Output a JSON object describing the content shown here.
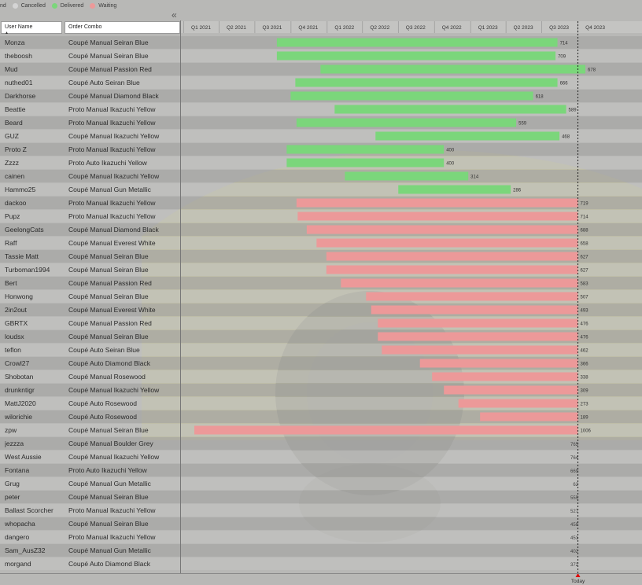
{
  "legend": {
    "items": [
      {
        "label": "nd",
        "color": ""
      },
      {
        "label": "Cancelled",
        "color": "#d4d4d4"
      },
      {
        "label": "Delivered",
        "color": "#7bd67b"
      },
      {
        "label": "Waiting",
        "color": "#ec9999"
      }
    ]
  },
  "table": {
    "headers": {
      "user": "User Name",
      "order": "Order Combo"
    },
    "rows": [
      {
        "user": "Monza",
        "order": "Coupé Manual Seiran Blue"
      },
      {
        "user": "theboosh",
        "order": "Coupé Manual Seiran Blue"
      },
      {
        "user": "Mud",
        "order": "Coupé Manual Passion Red"
      },
      {
        "user": "nuthed01",
        "order": "Coupé Auto Seiran Blue"
      },
      {
        "user": "Darkhorse",
        "order": "Coupé Manual Diamond Black"
      },
      {
        "user": "Beattie",
        "order": "Proto Manual Ikazuchi Yellow"
      },
      {
        "user": "Beard",
        "order": "Proto Manual Ikazuchi Yellow"
      },
      {
        "user": "GUZ",
        "order": "Coupé Manual Ikazuchi Yellow"
      },
      {
        "user": "Proto Z",
        "order": "Proto Manual Ikazuchi Yellow"
      },
      {
        "user": "Zzzz",
        "order": "Proto Auto Ikazuchi Yellow"
      },
      {
        "user": "cainen",
        "order": "Coupé Manual Ikazuchi Yellow"
      },
      {
        "user": "Hammo25",
        "order": "Coupé Manual Gun Metallic"
      },
      {
        "user": "dackoo",
        "order": "Proto Manual Ikazuchi Yellow"
      },
      {
        "user": "Pupz",
        "order": "Proto Manual Ikazuchi Yellow"
      },
      {
        "user": "GeelongCats",
        "order": "Coupé Manual Diamond Black"
      },
      {
        "user": "Raff",
        "order": "Coupé Manual Everest White"
      },
      {
        "user": "Tassie Matt",
        "order": "Coupé Manual Seiran Blue"
      },
      {
        "user": "Turboman1994",
        "order": "Coupé Manual Seiran Blue"
      },
      {
        "user": "Bert",
        "order": "Coupé Manual Passion Red"
      },
      {
        "user": "Honwong",
        "order": "Coupé Manual Seiran Blue"
      },
      {
        "user": "2in2out",
        "order": "Coupé Manual Everest White"
      },
      {
        "user": "GBRTX",
        "order": "Coupé Manual Passion Red"
      },
      {
        "user": "loudsx",
        "order": "Coupé Manual Seiran Blue"
      },
      {
        "user": "teflon",
        "order": "Coupé Auto Seiran Blue"
      },
      {
        "user": "Crowl27",
        "order": "Coupé Auto Diamond Black"
      },
      {
        "user": "Shobotan",
        "order": "Coupé Manual Rosewood"
      },
      {
        "user": "drunkntigr",
        "order": "Coupé Manual Ikazuchi Yellow"
      },
      {
        "user": "MattJ2020",
        "order": "Coupé Auto Rosewood"
      },
      {
        "user": "wilorichie",
        "order": "Coupé Auto Rosewood"
      },
      {
        "user": "zpw",
        "order": "Coupé Manual Seiran Blue"
      },
      {
        "user": "jezzza",
        "order": "Coupé Manual Boulder Grey"
      },
      {
        "user": "West Aussie",
        "order": "Coupé Manual Ikazuchi Yellow"
      },
      {
        "user": "Fontana",
        "order": "Proto Auto Ikazuchi Yellow"
      },
      {
        "user": "Grug",
        "order": "Coupé Manual Gun Metallic"
      },
      {
        "user": "peter",
        "order": "Coupé Manual Seiran Blue"
      },
      {
        "user": "Ballast Scorcher",
        "order": "Proto Manual Ikazuchi Yellow"
      },
      {
        "user": "whopacha",
        "order": "Coupé Manual Seiran Blue"
      },
      {
        "user": "dangero",
        "order": "Proto Manual Ikazuchi Yellow"
      },
      {
        "user": "Sam_AusZ32",
        "order": "Coupé Manual Gun Metallic"
      },
      {
        "user": "morgand",
        "order": "Coupé Auto Diamond Black"
      }
    ]
  },
  "chart_data": {
    "type": "bar",
    "subtype": "gantt",
    "x_axis": {
      "ticks": [
        "Q1 2021",
        "Q2 2021",
        "Q3 2021",
        "Q4 2021",
        "Q1 2022",
        "Q2 2022",
        "Q3 2022",
        "Q4 2022",
        "Q1 2023",
        "Q2 2023",
        "Q3 2023",
        "Q4 2023"
      ],
      "range": [
        "2020-12-25",
        "2023-12-31"
      ]
    },
    "today_marker": {
      "label": "Today",
      "date": "2023-10-01"
    },
    "colors": {
      "Delivered": "#7bd67b",
      "Waiting": "#ec9999",
      "Cancelled": "#d4d4d4"
    },
    "rows": [
      {
        "status": "Delivered",
        "start": "2021-08-26",
        "end": "2023-08-10",
        "days": 714
      },
      {
        "status": "Delivered",
        "start": "2021-08-26",
        "end": "2023-08-05",
        "days": 709
      },
      {
        "status": "Delivered",
        "start": "2021-12-15",
        "end": "2023-10-20",
        "days": 678
      },
      {
        "status": "Delivered",
        "start": "2021-10-12",
        "end": "2023-08-10",
        "days": 666
      },
      {
        "status": "Delivered",
        "start": "2021-09-30",
        "end": "2023-06-09",
        "days": 618
      },
      {
        "status": "Delivered",
        "start": "2022-01-20",
        "end": "2023-09-01",
        "days": 589
      },
      {
        "status": "Delivered",
        "start": "2021-10-15",
        "end": "2023-04-27",
        "days": 559
      },
      {
        "status": "Delivered",
        "start": "2022-05-04",
        "end": "2023-08-15",
        "days": 468
      },
      {
        "status": "Delivered",
        "start": "2021-09-20",
        "end": "2022-10-25",
        "days": 400
      },
      {
        "status": "Delivered",
        "start": "2021-09-20",
        "end": "2022-10-25",
        "days": 400
      },
      {
        "status": "Delivered",
        "start": "2022-02-15",
        "end": "2022-12-26",
        "days": 314
      },
      {
        "status": "Delivered",
        "start": "2022-07-01",
        "end": "2023-04-13",
        "days": 286
      },
      {
        "status": "Waiting",
        "start": "2021-10-15",
        "end": "2023-10-01",
        "days": 719
      },
      {
        "status": "Waiting",
        "start": "2021-10-18",
        "end": "2023-10-01",
        "days": 714
      },
      {
        "status": "Waiting",
        "start": "2021-11-10",
        "end": "2023-10-01",
        "days": 688
      },
      {
        "status": "Waiting",
        "start": "2021-12-05",
        "end": "2023-10-01",
        "days": 658
      },
      {
        "status": "Waiting",
        "start": "2021-12-30",
        "end": "2023-10-01",
        "days": 627
      },
      {
        "status": "Waiting",
        "start": "2021-12-30",
        "end": "2023-10-01",
        "days": 627
      },
      {
        "status": "Waiting",
        "start": "2022-02-05",
        "end": "2023-10-01",
        "days": 583
      },
      {
        "status": "Waiting",
        "start": "2022-04-10",
        "end": "2023-10-01",
        "days": 507
      },
      {
        "status": "Waiting",
        "start": "2022-04-23",
        "end": "2023-10-01",
        "days": 493
      },
      {
        "status": "Waiting",
        "start": "2022-05-10",
        "end": "2023-10-01",
        "days": 476
      },
      {
        "status": "Waiting",
        "start": "2022-05-10",
        "end": "2023-10-01",
        "days": 476
      },
      {
        "status": "Waiting",
        "start": "2022-05-20",
        "end": "2023-10-01",
        "days": 462
      },
      {
        "status": "Waiting",
        "start": "2022-08-25",
        "end": "2023-10-01",
        "days": 366
      },
      {
        "status": "Waiting",
        "start": "2022-09-25",
        "end": "2023-10-01",
        "days": 338
      },
      {
        "status": "Waiting",
        "start": "2022-10-25",
        "end": "2023-10-01",
        "days": 309
      },
      {
        "status": "Waiting",
        "start": "2022-12-01",
        "end": "2023-10-01",
        "days": 273
      },
      {
        "status": "Waiting",
        "start": "2023-01-25",
        "end": "2023-10-01",
        "days": 189
      },
      {
        "status": "Waiting",
        "start": "2021-01-28",
        "end": "2023-10-01",
        "days": 1006
      },
      {
        "status": "Cancelled",
        "start": "",
        "end": "",
        "days": 765
      },
      {
        "status": "Cancelled",
        "start": "",
        "end": "",
        "days": 764
      },
      {
        "status": "Cancelled",
        "start": "",
        "end": "",
        "days": 669
      },
      {
        "status": "Cancelled",
        "start": "",
        "end": "",
        "days": 62
      },
      {
        "status": "Cancelled",
        "start": "",
        "end": "",
        "days": 555
      },
      {
        "status": "Cancelled",
        "start": "",
        "end": "",
        "days": 527
      },
      {
        "status": "Cancelled",
        "start": "",
        "end": "",
        "days": 458
      },
      {
        "status": "Cancelled",
        "start": "",
        "end": "",
        "days": 451
      },
      {
        "status": "Cancelled",
        "start": "",
        "end": "",
        "days": 402
      },
      {
        "status": "Cancelled",
        "start": "",
        "end": "",
        "days": 372
      }
    ]
  }
}
